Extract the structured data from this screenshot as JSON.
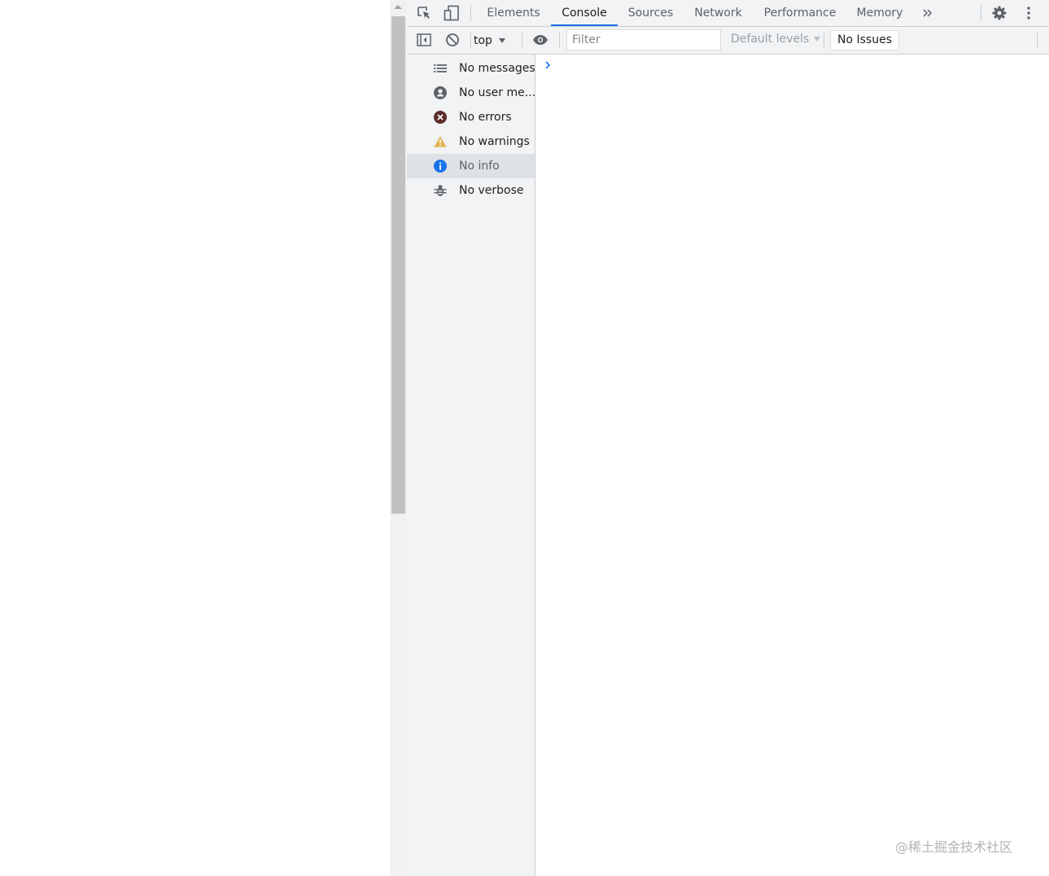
{
  "devtools": {
    "tabs": [
      {
        "label": "Elements",
        "active": false
      },
      {
        "label": "Console",
        "active": true
      },
      {
        "label": "Sources",
        "active": false
      },
      {
        "label": "Network",
        "active": false
      },
      {
        "label": "Performance",
        "active": false
      },
      {
        "label": "Memory",
        "active": false
      }
    ],
    "more_tabs_icon": "double-chevron-right-icon",
    "toolbar": {
      "context": "top",
      "filter_placeholder": "Filter",
      "levels": "Default levels",
      "issues": "No Issues"
    },
    "sidebar": [
      {
        "label": "No messages",
        "icon": "list-icon",
        "selected": false
      },
      {
        "label": "No user me...",
        "icon": "user-icon",
        "selected": false
      },
      {
        "label": "No errors",
        "icon": "error-icon",
        "selected": false
      },
      {
        "label": "No warnings",
        "icon": "warning-icon",
        "selected": false
      },
      {
        "label": "No info",
        "icon": "info-icon",
        "selected": true
      },
      {
        "label": "No verbose",
        "icon": "bug-icon",
        "selected": false
      }
    ],
    "colors": {
      "accent": "#1a73e8",
      "error": "#5c2b2b",
      "warning": "#e2b24d",
      "info": "#1a73e8"
    }
  },
  "watermark": "@稀土掘金技术社区"
}
